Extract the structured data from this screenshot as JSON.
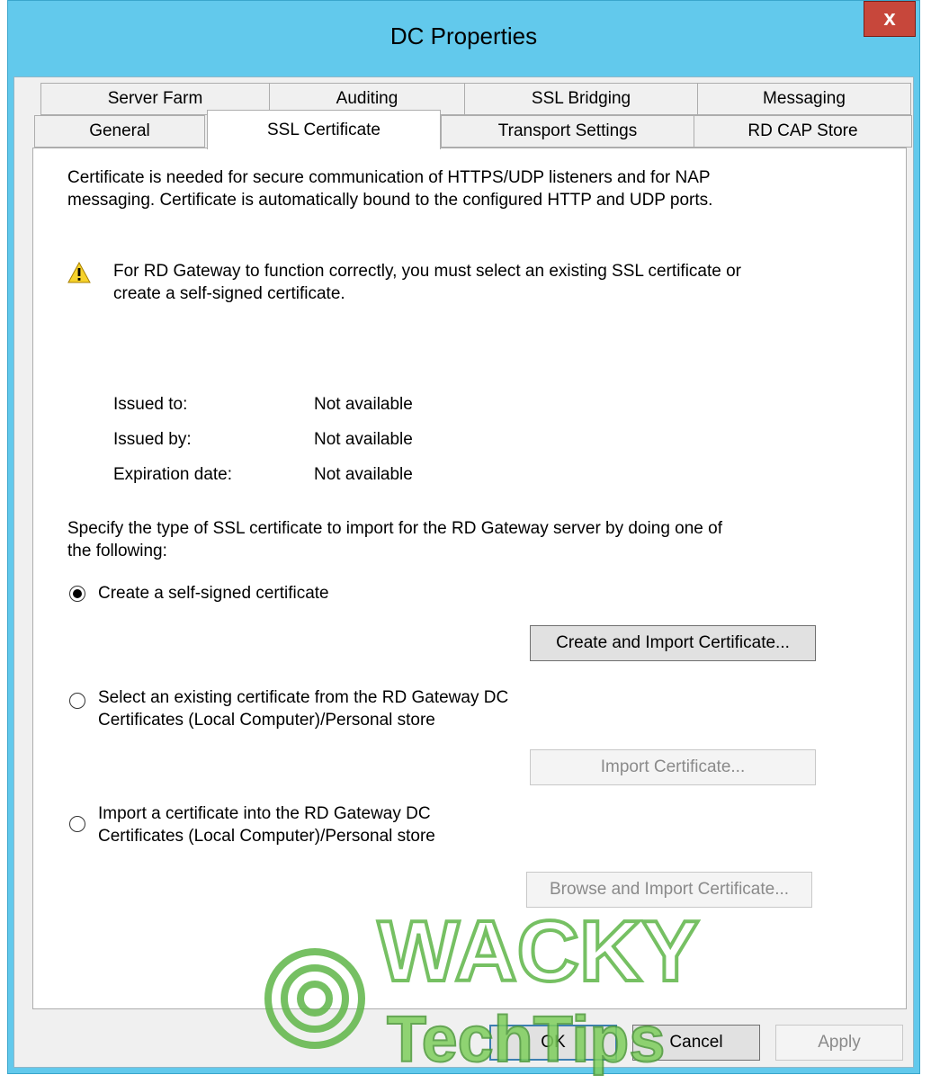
{
  "window": {
    "title": "DC Properties",
    "close_label": "x"
  },
  "tabs": {
    "row_top": [
      "Server Farm",
      "Auditing",
      "SSL Bridging",
      "Messaging"
    ],
    "row_bottom": [
      "General",
      "SSL Certificate",
      "Transport Settings",
      "RD CAP Store"
    ],
    "active": "SSL Certificate"
  },
  "content": {
    "intro_line1": "Certificate is needed for secure communication of HTTPS/UDP listeners and for NAP",
    "intro_line2": "messaging. Certificate is automatically bound to the configured HTTP and UDP ports.",
    "warning_line1": "For RD Gateway to function correctly, you must select an existing SSL certificate or",
    "warning_line2": "create a self-signed certificate.",
    "issued_to_label": "Issued to:",
    "issued_to_value": "Not available",
    "issued_by_label": "Issued by:",
    "issued_by_value": "Not available",
    "expiration_label": "Expiration date:",
    "expiration_value": "Not available",
    "specify_line1": "Specify the type of SSL certificate to import for the RD Gateway server by doing one of",
    "specify_line2": "the following:",
    "option1_label": "Create a self-signed certificate",
    "option1_button": "Create and Import Certificate...",
    "option2_line1": "Select an existing certificate from the RD Gateway DC",
    "option2_line2": "Certificates (Local Computer)/Personal store",
    "option2_button": "Import Certificate...",
    "option3_line1": "Import a certificate into the RD Gateway DC",
    "option3_line2": "Certificates (Local Computer)/Personal store",
    "option3_button": "Browse and Import Certificate...",
    "selected_option": "Create a self-signed certificate"
  },
  "footer": {
    "ok": "OK",
    "cancel": "Cancel",
    "apply": "Apply"
  },
  "watermark": {
    "line1": "WACKY",
    "line2": "TechTips"
  },
  "colors": {
    "titlebar": "#62c9ec",
    "close": "#c7473b",
    "watermark": "#5fb648"
  }
}
